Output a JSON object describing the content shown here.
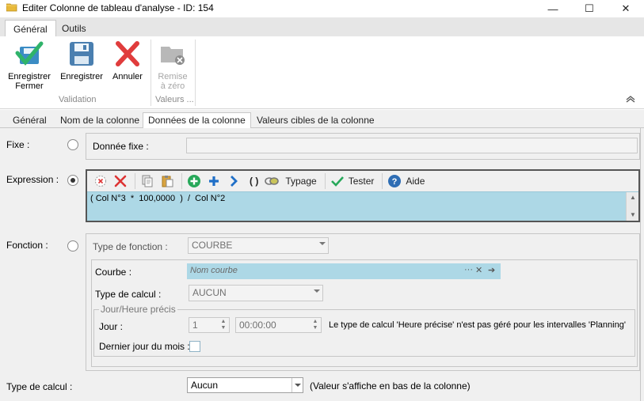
{
  "window": {
    "title": "Editer Colonne de tableau d'analyse - ID: 154",
    "minimize": "—",
    "maximize": "☐",
    "close": "✕"
  },
  "ribbon": {
    "tabs": [
      "Général",
      "Outils"
    ],
    "buttons": {
      "save_close": "Enregistrer\nFermer",
      "save": "Enregistrer",
      "cancel": "Annuler",
      "reset": "Remise\nà zéro"
    },
    "groups": {
      "validation": "Validation",
      "values": "Valeurs ..."
    }
  },
  "page_tabs": [
    "Général",
    "Nom de la colonne",
    "Données de la colonne",
    "Valeurs cibles de la colonne"
  ],
  "fixe": {
    "label": "Fixe :",
    "field_label": "Donnée fixe :",
    "value": ""
  },
  "expression": {
    "label": "Expression :",
    "toolbar": {
      "typage": "Typage",
      "tester": "Tester",
      "aide": "Aide",
      "parens": "( )"
    },
    "text": "( Col N°3  *  100,0000  )  /  Col N°2"
  },
  "fonction": {
    "label": "Fonction :",
    "type_label": "Type de fonction :",
    "type_value": "COURBE",
    "courbe_label": "Courbe :",
    "courbe_placeholder": "Nom courbe",
    "courbe_dots": "···",
    "courbe_clear": "✕",
    "courbe_go": "➔",
    "calc_label": "Type de calcul :",
    "calc_value": "AUCUN",
    "group_title": "Jour/Heure précis",
    "jour_label": "Jour :",
    "jour_value": "1",
    "time_value": "00:00:00",
    "note": "Le type de calcul 'Heure précise' n'est pas géré pour les intervalles 'Planning'",
    "last_day_label": "Dernier jour du mois :"
  },
  "bottom": {
    "label": "Type de calcul :",
    "value": "Aucun",
    "note": "(Valeur s'affiche en bas de la colonne)"
  }
}
